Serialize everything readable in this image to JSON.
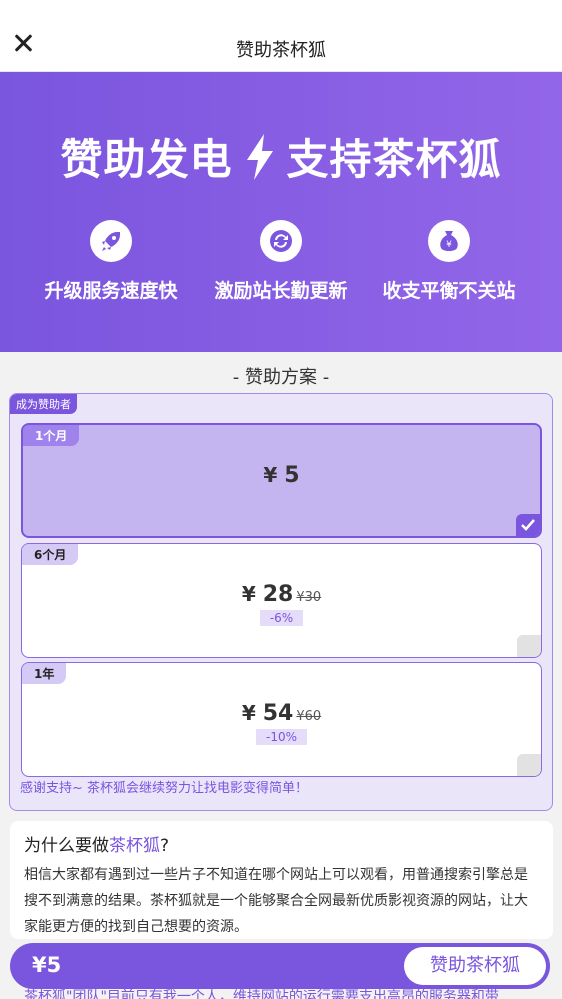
{
  "header": {
    "title": "赞助茶杯狐"
  },
  "hero": {
    "headline_left": "赞助发电",
    "headline_right": "支持茶杯狐",
    "features": [
      {
        "icon": "rocket-icon",
        "label": "升级服务速度快"
      },
      {
        "icon": "refresh-icon",
        "label": "激励站长勤更新"
      },
      {
        "icon": "money-bag-icon",
        "label": "收支平衡不关站"
      }
    ]
  },
  "plans": {
    "section_title": "- 赞助方案 -",
    "tag": "成为赞助者",
    "items": [
      {
        "period": "1个月",
        "currency": "¥",
        "price": "5",
        "old_price": "",
        "discount": "",
        "selected": true
      },
      {
        "period": "6个月",
        "currency": "¥",
        "price": "28",
        "old_price": "¥30",
        "discount": "-6%",
        "selected": false
      },
      {
        "period": "1年",
        "currency": "¥",
        "price": "54",
        "old_price": "¥60",
        "discount": "-10%",
        "selected": false
      }
    ],
    "thanks": "感谢支持~ 茶杯狐会继续努力让找电影变得简单！"
  },
  "why": {
    "title_prefix": "为什么要做",
    "title_brand": "茶杯狐",
    "title_suffix": "?",
    "body": "相信大家都有遇到过一些片子不知道在哪个网站上可以观看，用普通搜索引擎总是搜不到满意的结果。茶杯狐就是一个能够聚合全网最新优质影视资源的网站，让大家能更方便的找到自己想要的资源。"
  },
  "bottom_bar": {
    "price": "¥5",
    "button_label": "赞助茶杯狐"
  },
  "footer_peek": "茶杯狐\"团队\"目前只有我一个人，维持网站的运行需要支出高昂的服务器和带",
  "colors": {
    "accent": "#7a55de",
    "accent_light": "#9366e8",
    "selected_bg": "#c4b5f0",
    "panel_bg": "#ebe5fa"
  }
}
